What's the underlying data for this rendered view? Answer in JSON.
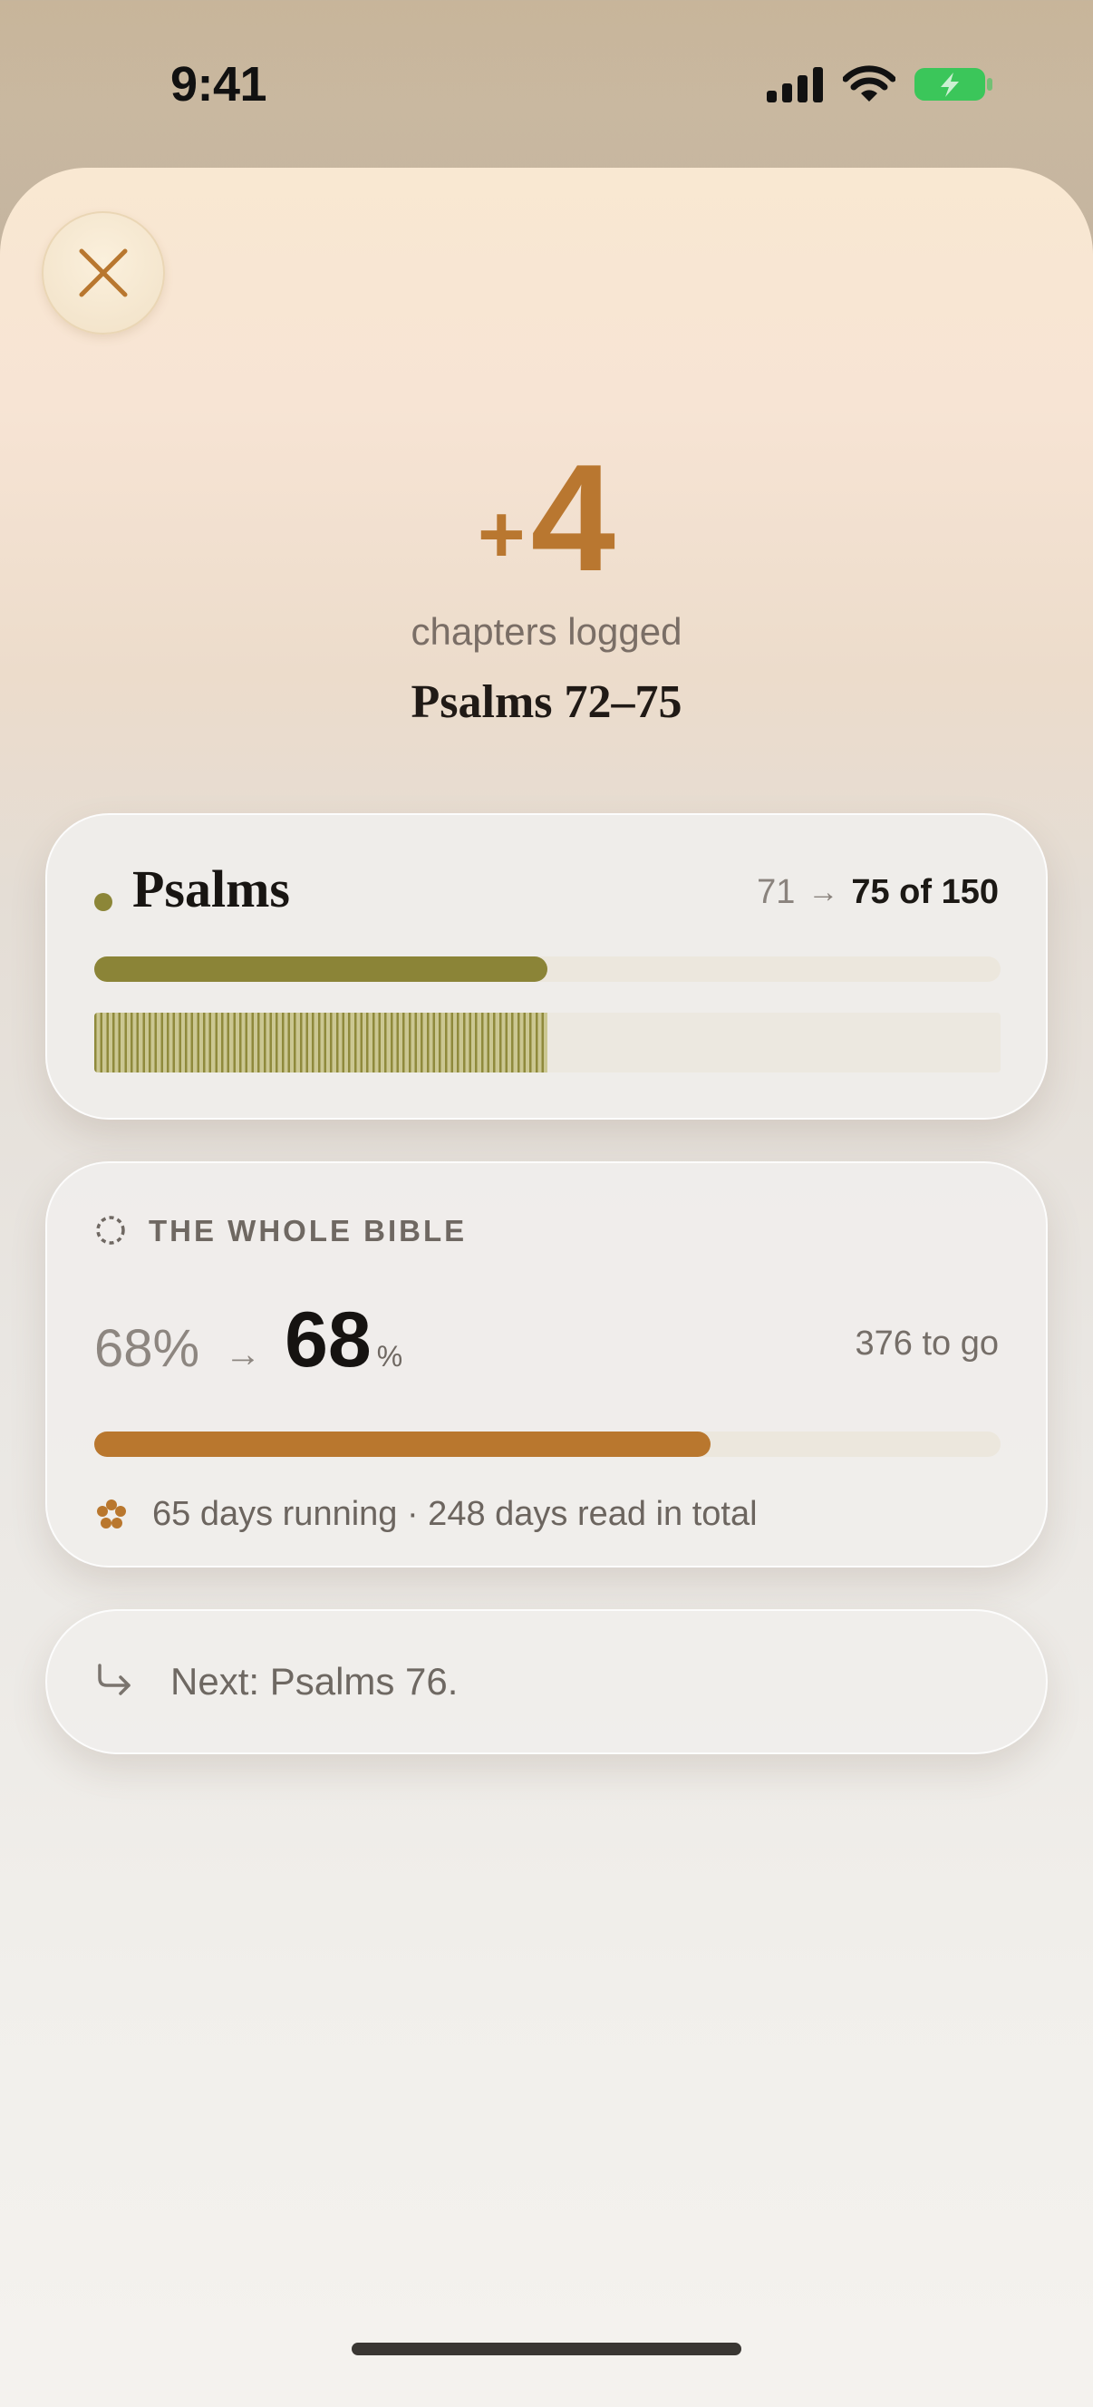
{
  "status_bar": {
    "time": "9:41"
  },
  "summary": {
    "plus_sign": "+",
    "count": "4",
    "caption": "chapters logged",
    "range": "Psalms 72–75"
  },
  "book_card": {
    "name": "Psalms",
    "from": "71",
    "arrow": "→",
    "to_text": "75 of 150",
    "chapters_read": 75,
    "chapters_total": 150,
    "accent": "#8b8437"
  },
  "bible_card": {
    "label": "THE WHOLE BIBLE",
    "from_pct": "68%",
    "arrow": "→",
    "to_pct": "68",
    "unit": "%",
    "remaining": "376 to go",
    "progress_fraction": 0.68,
    "streak": "65 days running · 248 days read in total",
    "accent": "#b9772e"
  },
  "next_card": {
    "text": "Next: Psalms 76."
  },
  "icons": {
    "close": "close-icon",
    "bible": "dashed-circle-icon",
    "streak": "flower-icon",
    "next": "return-arrow-icon"
  }
}
